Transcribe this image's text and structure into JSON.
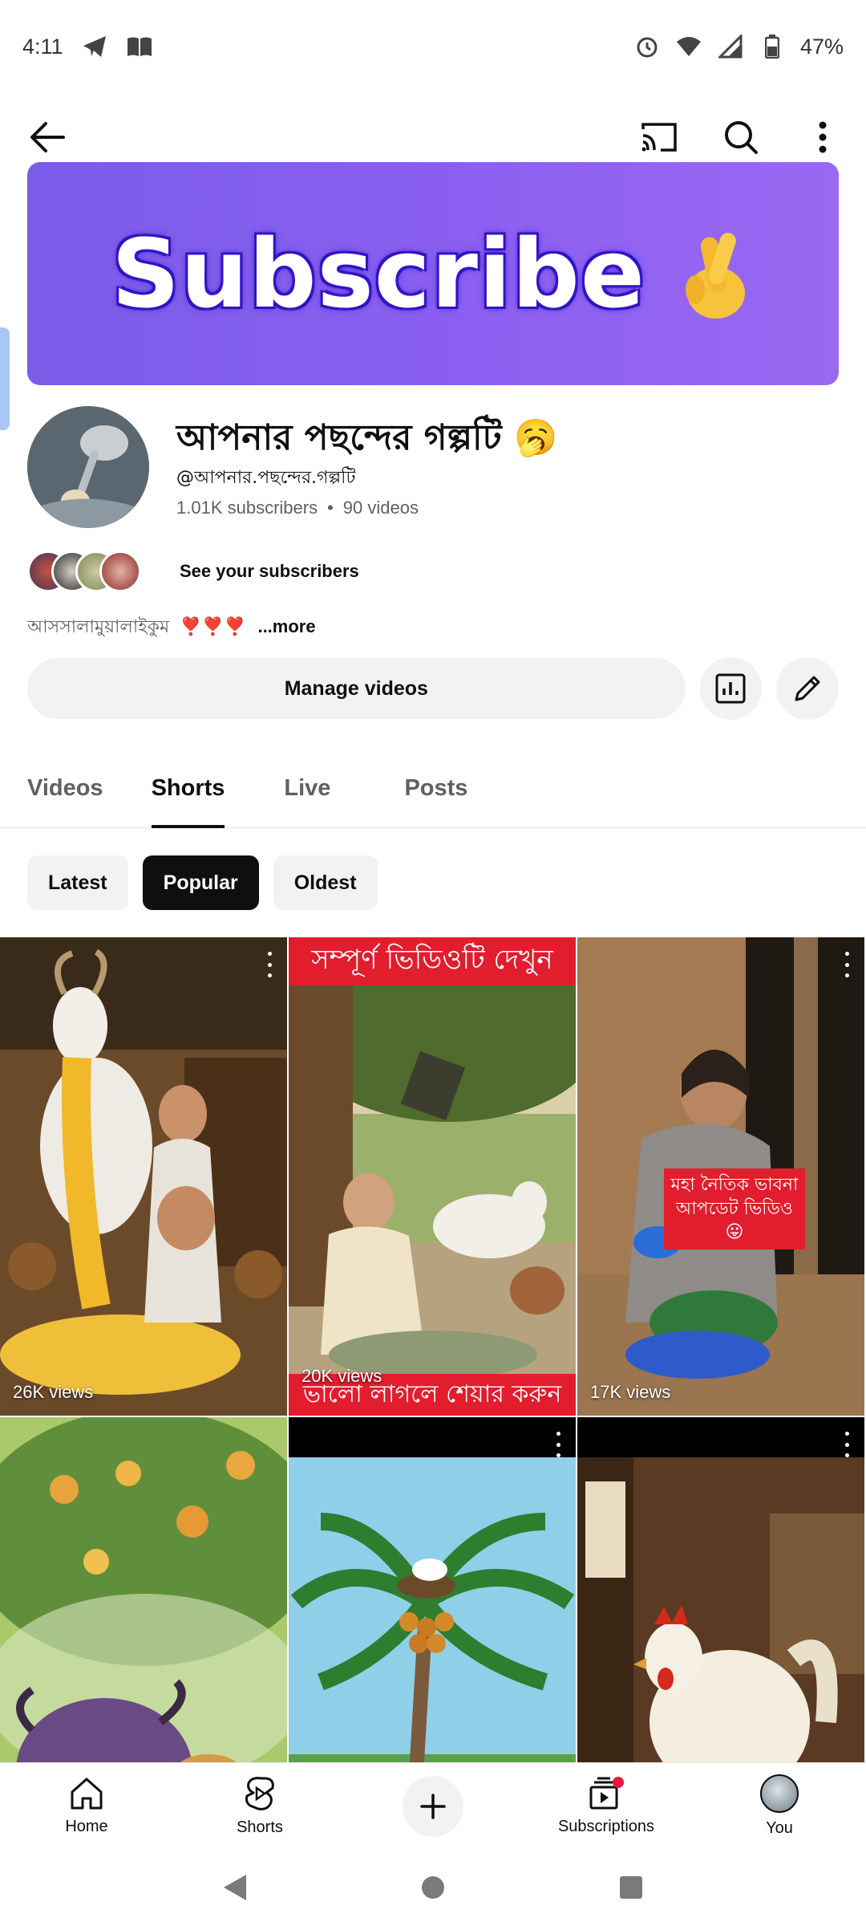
{
  "status_bar": {
    "time": "4:11",
    "battery": "47%",
    "icons_left": [
      "telegram-icon",
      "book-icon"
    ],
    "icons_right": [
      "alarm-icon",
      "wifi-icon",
      "signal-icon",
      "battery-icon"
    ]
  },
  "app_bar": {
    "icons": [
      "back-arrow-icon",
      "cast-icon",
      "search-icon",
      "more-vert-icon"
    ]
  },
  "banner": {
    "text": "Subscribe",
    "emoji": "🤞",
    "bg_color": "#8a5ff0"
  },
  "channel": {
    "name": "আপনার পছন্দের গল্পটি",
    "name_emoji": "🥱",
    "handle": "@আপনার.পছন্দের.গল্পটি",
    "subscribers": "1.01K subscribers",
    "videos": "90 videos",
    "separator": "•",
    "see_subscribers": "See your subscribers",
    "description": "আসসালামুয়ালাইকুম",
    "description_hearts": "❣️❣️❣️",
    "more": "...more"
  },
  "actions": {
    "manage_videos": "Manage videos",
    "icons": [
      "analytics-icon",
      "edit-pencil-icon"
    ]
  },
  "tabs": [
    {
      "label": "Videos",
      "active": false
    },
    {
      "label": "Shorts",
      "active": true
    },
    {
      "label": "Live",
      "active": false
    },
    {
      "label": "Posts",
      "active": false
    }
  ],
  "chips": [
    {
      "label": "Latest",
      "active": false
    },
    {
      "label": "Popular",
      "active": true
    },
    {
      "label": "Oldest",
      "active": false
    }
  ],
  "shorts": [
    {
      "views": "26K views",
      "overlay_top": "",
      "overlay_bottom": "",
      "overlay_mid": ""
    },
    {
      "views": "20K views",
      "overlay_top": "সম্পূর্ণ ভিডিওটি দেখুন",
      "overlay_bottom": "ভালো লাগলে শেয়ার করুন",
      "overlay_mid": ""
    },
    {
      "views": "17K views",
      "overlay_top": "",
      "overlay_bottom": "",
      "overlay_mid": "মহা নৈতিক ভাবনা আপডেট ভিডিও 😛"
    },
    {
      "views": "",
      "overlay_top": "",
      "overlay_bottom": "",
      "overlay_mid": ""
    },
    {
      "views": "",
      "overlay_top": "",
      "overlay_bottom": "",
      "overlay_mid": ""
    },
    {
      "views": "",
      "overlay_top": "",
      "overlay_bottom": "",
      "overlay_mid": ""
    }
  ],
  "bottom_nav": [
    {
      "label": "Home",
      "icon": "home-icon"
    },
    {
      "label": "Shorts",
      "icon": "shorts-icon"
    },
    {
      "label": "",
      "icon": "create-plus-icon"
    },
    {
      "label": "Subscriptions",
      "icon": "subscriptions-icon"
    },
    {
      "label": "You",
      "icon": "profile-avatar-icon"
    }
  ],
  "system_nav": [
    "back-triangle-icon",
    "home-circle-icon",
    "recents-square-icon"
  ]
}
